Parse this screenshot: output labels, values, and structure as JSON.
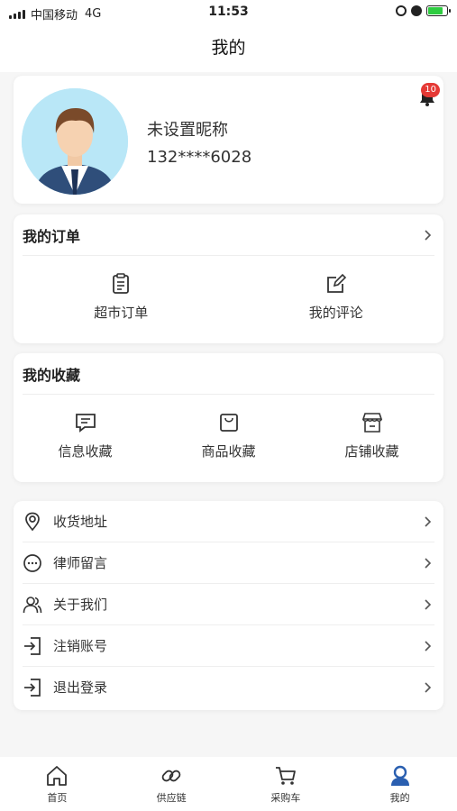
{
  "status_bar": {
    "carrier": "中国移动",
    "network": "4G",
    "time": "11:53"
  },
  "header": {
    "title": "我的"
  },
  "profile": {
    "nickname": "未设置昵称",
    "phone": "132****6028",
    "notification_count": "10",
    "notification_icon": "bell-icon"
  },
  "orders": {
    "title": "我的订单",
    "items": [
      {
        "label": "超市订单",
        "icon": "clipboard-icon"
      },
      {
        "label": "我的评论",
        "icon": "edit-icon"
      }
    ]
  },
  "favorites": {
    "title": "我的收藏",
    "items": [
      {
        "label": "信息收藏",
        "icon": "message-icon"
      },
      {
        "label": "商品收藏",
        "icon": "bag-icon"
      },
      {
        "label": "店铺收藏",
        "icon": "store-icon"
      }
    ]
  },
  "menu": {
    "items": [
      {
        "label": "收货地址",
        "icon": "location-icon"
      },
      {
        "label": "律师留言",
        "icon": "chat-icon"
      },
      {
        "label": "关于我们",
        "icon": "users-icon"
      },
      {
        "label": "注销账号",
        "icon": "logout-icon"
      },
      {
        "label": "退出登录",
        "icon": "exit-icon"
      }
    ]
  },
  "tabbar": {
    "items": [
      {
        "label": "首页",
        "icon": "home-icon"
      },
      {
        "label": "供应链",
        "icon": "link-icon"
      },
      {
        "label": "采购车",
        "icon": "cart-icon"
      },
      {
        "label": "我的",
        "icon": "user-icon"
      }
    ],
    "active_color": "#2a5fb0"
  },
  "colors": {
    "badge": "#e53935",
    "avatar_bg": "#b9e7f7"
  }
}
